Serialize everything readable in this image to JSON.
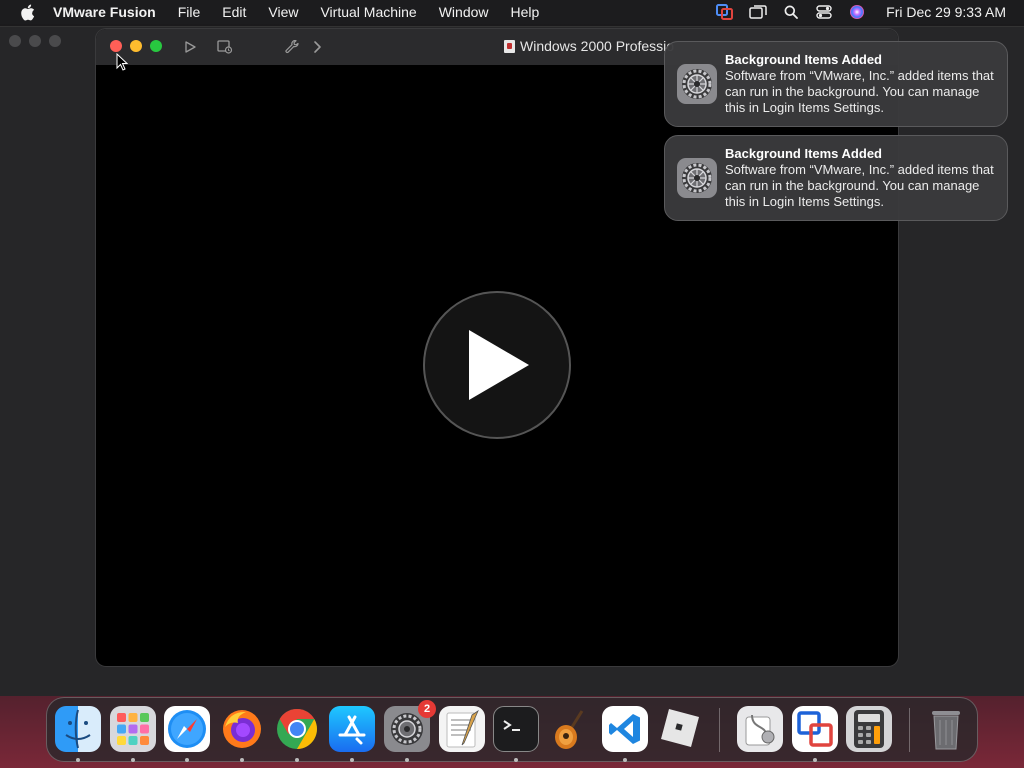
{
  "menubar": {
    "app_name": "VMware Fusion",
    "items": [
      "File",
      "Edit",
      "View",
      "Virtual Machine",
      "Window",
      "Help"
    ],
    "status_icons": [
      "vmware-status-icon",
      "screen-mirroring-icon",
      "spotlight-search-icon",
      "control-center-icon",
      "siri-icon"
    ],
    "clock": "Fri Dec 29  9:33 AM"
  },
  "vm_window": {
    "title": "Windows 2000 Professio",
    "toolbar_icons": [
      "play-icon",
      "snapshot-icon",
      "settings-wrench-icon",
      "chevron-right-icon"
    ],
    "traffic_lights": {
      "close": "#ff5f57",
      "minimize": "#febc2e",
      "zoom": "#28c840"
    }
  },
  "notifications": [
    {
      "title": "Background Items Added",
      "body": "Software from “VMware, Inc.” added items that can run in the background. You can manage this in Login Items Settings."
    },
    {
      "title": "Background Items Added",
      "body": "Software from “VMware, Inc.” added items that can run in the background. You can manage this in Login Items Settings."
    }
  ],
  "dock": {
    "apps": [
      {
        "name": "Finder",
        "icon": "finder-icon",
        "running": true
      },
      {
        "name": "Launchpad",
        "icon": "launchpad-icon",
        "running": true
      },
      {
        "name": "Safari",
        "icon": "safari-icon",
        "running": true
      },
      {
        "name": "Firefox",
        "icon": "firefox-icon",
        "running": true
      },
      {
        "name": "Google Chrome",
        "icon": "chrome-icon",
        "running": true
      },
      {
        "name": "App Store",
        "icon": "app-store-icon",
        "running": true
      },
      {
        "name": "System Settings",
        "icon": "system-settings-icon",
        "running": true,
        "badge": "2"
      },
      {
        "name": "TextEdit",
        "icon": "textedit-icon",
        "running": false
      },
      {
        "name": "Terminal",
        "icon": "terminal-icon",
        "running": true
      },
      {
        "name": "GarageBand",
        "icon": "garageband-icon",
        "running": false
      },
      {
        "name": "Visual Studio Code",
        "icon": "vscode-icon",
        "running": true
      },
      {
        "name": "Roblox",
        "icon": "roblox-icon",
        "running": false
      },
      {
        "name": "Disk Utility",
        "icon": "disk-utility-icon",
        "running": false
      },
      {
        "name": "VMware Fusion",
        "icon": "vmware-fusion-icon",
        "running": true
      },
      {
        "name": "Calculator",
        "icon": "calculator-icon",
        "running": false
      },
      {
        "name": "Trash",
        "icon": "trash-icon",
        "running": false
      }
    ]
  }
}
